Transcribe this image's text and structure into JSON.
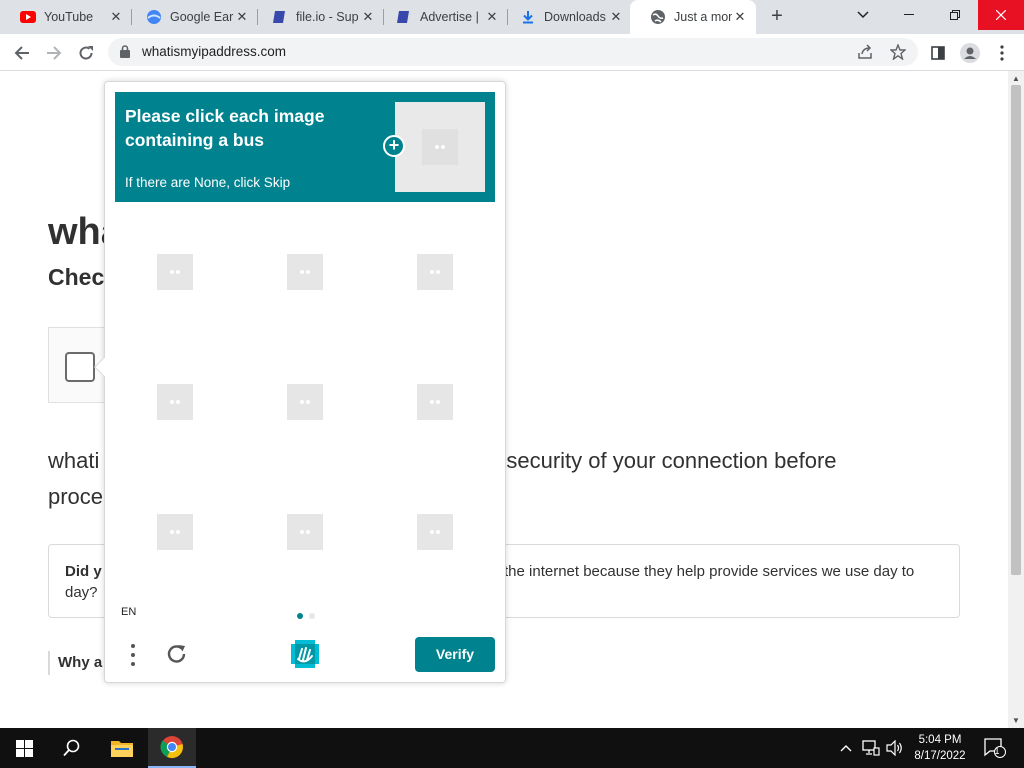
{
  "browser": {
    "tabs": [
      {
        "title": "YouTube",
        "icon": "youtube-icon"
      },
      {
        "title": "Google Ear",
        "icon": "google-earth-icon"
      },
      {
        "title": "file.io - Sup",
        "icon": "file-io-icon"
      },
      {
        "title": "Advertise |",
        "icon": "advertise-icon"
      },
      {
        "title": "Downloads",
        "icon": "download-icon"
      },
      {
        "title": "Just a mom",
        "icon": "globe-icon"
      }
    ],
    "url": "whatismyipaddress.com"
  },
  "page": {
    "title": "wha",
    "subtitle": "Check",
    "para_left": "whati",
    "para_right": "e security of your connection before",
    "para_left2": "proce",
    "info_left": "Did y",
    "info_left2": "day?",
    "info_right": "the internet because they help provide services we use day to",
    "why": "Why a"
  },
  "captcha": {
    "prompt": "Please click each image containing a bus",
    "sub": "If there are None, click Skip",
    "language": "EN",
    "verify_label": "Verify",
    "tile_count": 9,
    "page_index": 1,
    "page_count": 2,
    "accent_color": "#00838f"
  },
  "taskbar": {
    "time": "5:04 PM",
    "date": "8/17/2022",
    "notification_count": "1"
  }
}
